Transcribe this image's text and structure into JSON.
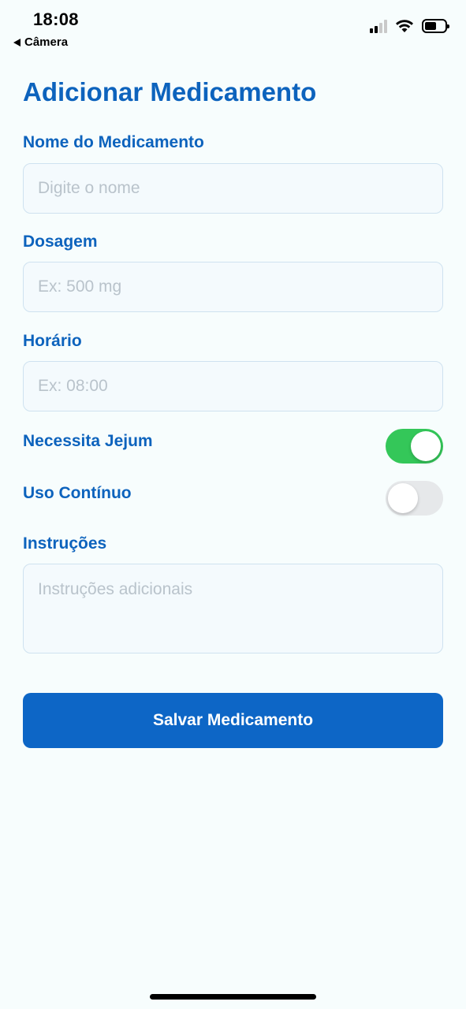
{
  "status_bar": {
    "time": "18:08",
    "back_label": "Câmera",
    "signal_icon": "cellular-signal-icon",
    "wifi_icon": "wifi-icon",
    "battery_icon": "battery-icon"
  },
  "form": {
    "title": "Adicionar Medicamento",
    "name": {
      "label": "Nome do Medicamento",
      "placeholder": "Digite o nome"
    },
    "dosage": {
      "label": "Dosagem",
      "placeholder": "Ex: 500 mg"
    },
    "time": {
      "label": "Horário",
      "placeholder": "Ex: 08:00"
    },
    "fasting": {
      "label": "Necessita Jejum",
      "enabled": true
    },
    "continuous": {
      "label": "Uso Contínuo",
      "enabled": false
    },
    "instructions": {
      "label": "Instruções",
      "placeholder": "Instruções adicionais"
    },
    "save_label": "Salvar Medicamento"
  },
  "colors": {
    "accent": "#0d63bd",
    "button": "#0d66c6",
    "toggle_on": "#34c759",
    "toggle_off": "#e6e8ea",
    "background": "#f7fdfd"
  }
}
